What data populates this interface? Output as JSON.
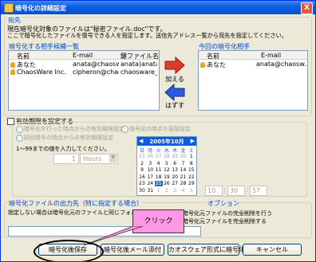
{
  "window": {
    "title": "暗号化の詳細設定",
    "close_label": "X"
  },
  "recipients": {
    "section_title": "宛先",
    "desc_line1": "現在暗号化対象のファイルは\"秘密ファイル.doc\"です。",
    "desc_line2": "ここで暗号化したファイルを復号できる人を指定します。送信先アドレス一覧から宛先を指定してください。",
    "candidates_title": "暗号化する相手候補一覧",
    "candidates_columns": [
      "名前",
      "E-mail",
      "鍵ファイル名"
    ],
    "candidates_rows": [
      [
        "あなた",
        "anata@chaosw...",
        "anata)anata..."
      ],
      [
        "ChaosWare Inc.",
        "cipheron@chaos...",
        "chaosware_v..."
      ]
    ],
    "current_title": "今回の暗号化相手",
    "current_columns": [
      "名前",
      "E-mail"
    ],
    "current_rows": [
      [
        "あなた",
        "anata@chaosw..."
      ]
    ],
    "add_label": "加える",
    "remove_label": "はずす"
  },
  "expiry": {
    "checkbox_label": "有効期限を設定する",
    "option1": "暗号化を行った時点からの有効期限設定",
    "option2": "復号化の時点を直接設定",
    "option3": "初回復号の時点からの有効期限設定",
    "range_text": "1～99までの値を入力してください。",
    "spin_value": "1",
    "unit_value": "Hours",
    "time_values": [
      "10",
      "30",
      "57"
    ],
    "time_sep": ":"
  },
  "calendar": {
    "title": "2005年10月",
    "prev": "◀",
    "next": "▶",
    "dow": [
      "日",
      "月",
      "火",
      "水",
      "木",
      "金",
      "土"
    ],
    "weeks": [
      [
        "25",
        "26",
        "27",
        "28",
        "29",
        "30",
        "1"
      ],
      [
        "2",
        "3",
        "4",
        "5",
        "6",
        "7",
        "8"
      ],
      [
        "9",
        "10",
        "11",
        "12",
        "13",
        "14",
        "15"
      ],
      [
        "16",
        "17",
        "18",
        "19",
        "20",
        "21",
        "22"
      ],
      [
        "23",
        "24",
        "25",
        "26",
        "27",
        "28",
        "29"
      ],
      [
        "30",
        "31",
        "1",
        "2",
        "3",
        "4",
        "5"
      ]
    ],
    "selected": "25"
  },
  "output": {
    "section_title": "暗号化ファイルの出力先（特に指定する場合）",
    "desc": "指定しない場合は暗号化元のファイルと同じフォルダに保存",
    "option_title": "オプション",
    "option_line1": "暗号化元ファイルの完全削除を行う",
    "option_line2": "暗号化元ファイルを完全削除する"
  },
  "buttons": {
    "save": "暗号化後保存",
    "mail": "暗号化後メール添付",
    "chaoswave": "カオスウェア形式に暗号化",
    "cancel": "キャンセル"
  },
  "callout": {
    "text": "クリック"
  }
}
